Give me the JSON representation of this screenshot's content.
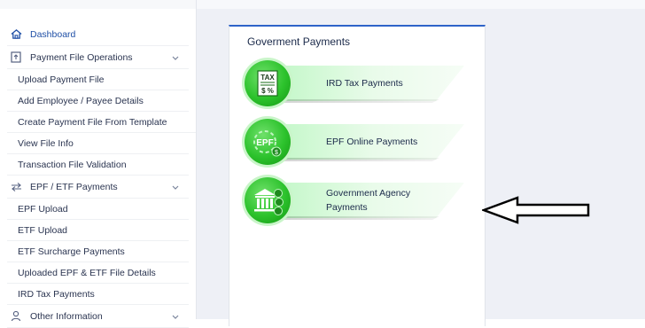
{
  "sidebar": {
    "items": [
      {
        "label": "Dashboard",
        "icon": "home-icon"
      },
      {
        "label": "Payment File Operations",
        "icon": "file-upload-icon"
      },
      {
        "label": "Upload Payment File"
      },
      {
        "label": "Add Employee / Payee Details"
      },
      {
        "label": "Create Payment File From Template"
      },
      {
        "label": "View File Info"
      },
      {
        "label": "Transaction File Validation"
      },
      {
        "label": "EPF / ETF Payments",
        "icon": "transfer-icon"
      },
      {
        "label": "EPF Upload"
      },
      {
        "label": "ETF Upload"
      },
      {
        "label": "ETF Surcharge Payments"
      },
      {
        "label": "Uploaded EPF & ETF File Details"
      },
      {
        "label": "IRD Tax Payments"
      },
      {
        "label": "Other Information",
        "icon": "user-icon"
      }
    ]
  },
  "card": {
    "title": "Goverment Payments",
    "buttons": [
      {
        "label": "IRD Tax Payments",
        "icon": "tax-document-icon",
        "icon_text_top": "TAX",
        "icon_text_bottom": "$ %"
      },
      {
        "label": "EPF Online Payments",
        "icon": "epf-coins-icon",
        "icon_text": "EPF"
      },
      {
        "label_line1": "Government Agency",
        "label_line2": "Payments",
        "icon": "government-building-icon"
      }
    ]
  },
  "colors": {
    "accent": "#2e63c9",
    "green": "#2cc22c",
    "banner": "#bdf7c3"
  },
  "annotation": {
    "icon": "left-arrow-icon"
  }
}
